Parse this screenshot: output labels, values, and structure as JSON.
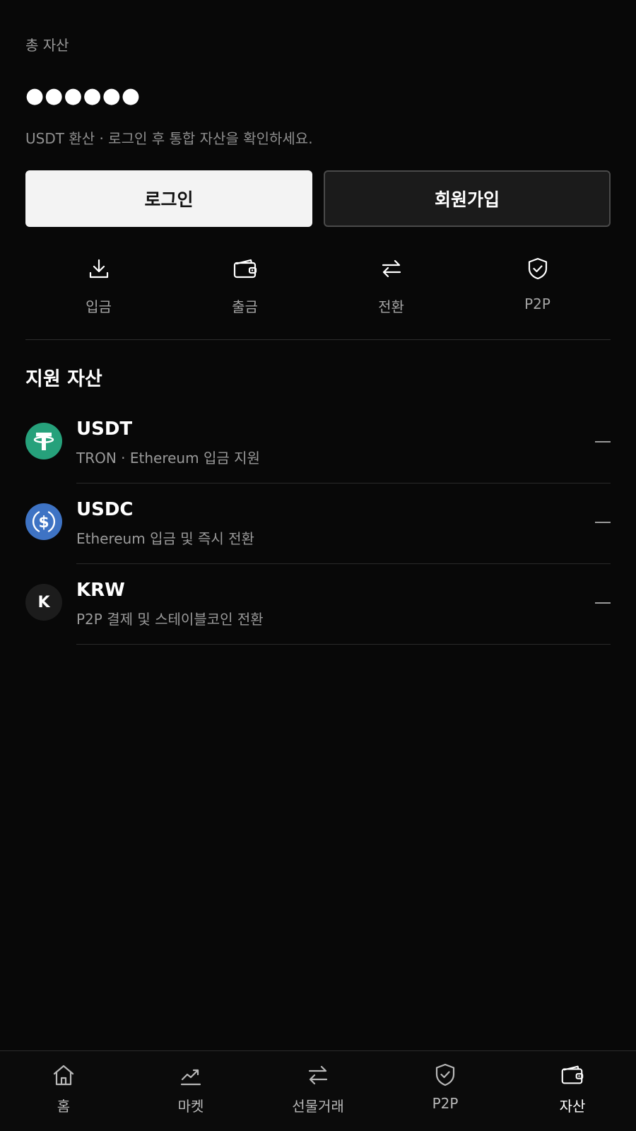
{
  "balance": {
    "label": "총 자산",
    "masked_value": "●●●●●●",
    "note": "USDT 환산 · 로그인 후 통합 자산을 확인하세요."
  },
  "auth": {
    "login_label": "로그인",
    "signup_label": "회원가입"
  },
  "quick_actions": [
    {
      "label": "입금",
      "icon": "download-icon"
    },
    {
      "label": "출금",
      "icon": "wallet-icon"
    },
    {
      "label": "전환",
      "icon": "swap-icon"
    },
    {
      "label": "P2P",
      "icon": "shield-check-icon"
    }
  ],
  "assets_section": {
    "title": "지원 자산",
    "items": [
      {
        "symbol": "USDT",
        "description": "TRON · Ethereum 입금 지원",
        "value": "—",
        "logo": "tether-logo",
        "logo_color": "#26a17b"
      },
      {
        "symbol": "USDC",
        "description": "Ethereum 입금 및 즉시 전환",
        "value": "—",
        "logo": "usdc-logo",
        "logo_color": "#3e73c4"
      },
      {
        "symbol": "KRW",
        "description": "P2P 결제 및 스테이블코인 전환",
        "value": "—",
        "logo": "krw-logo",
        "logo_text": "K",
        "logo_color": "#1c1c1c"
      }
    ]
  },
  "bottom_nav": [
    {
      "label": "홈",
      "icon": "home-icon",
      "active": false
    },
    {
      "label": "마켓",
      "icon": "chart-icon",
      "active": false
    },
    {
      "label": "선물거래",
      "icon": "swap-icon",
      "active": false
    },
    {
      "label": "P2P",
      "icon": "shield-check-icon",
      "active": false
    },
    {
      "label": "자산",
      "icon": "wallet-icon",
      "active": true
    }
  ],
  "colors": {
    "background": "#080808",
    "login_button": "#f3f3f3",
    "signup_button": "#1b1b1b",
    "muted_text": "#9a9a9a"
  }
}
